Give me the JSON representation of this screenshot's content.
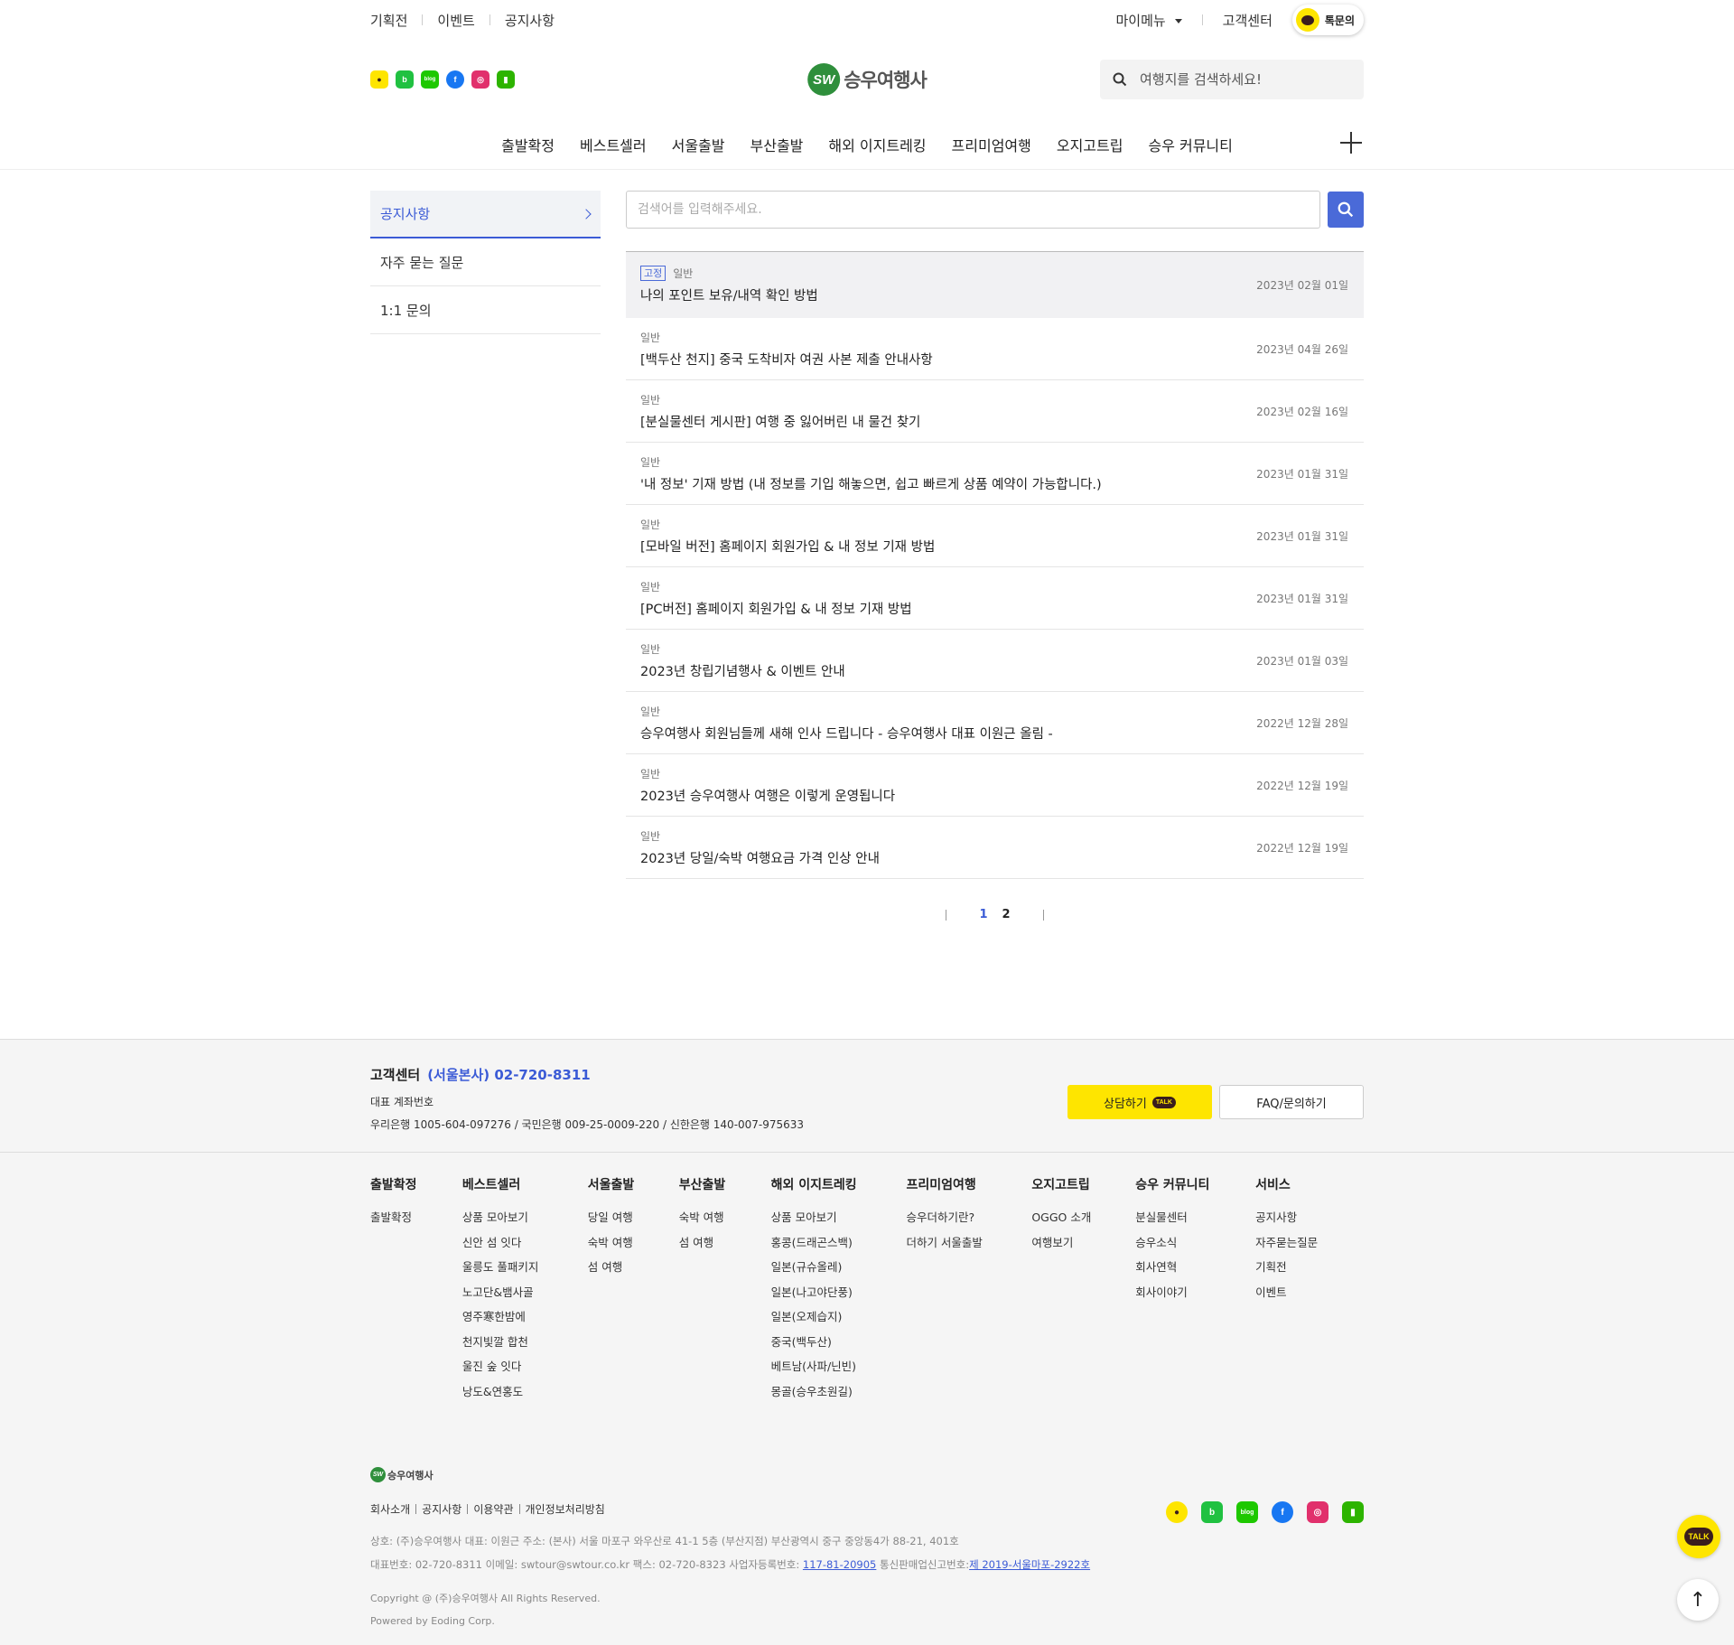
{
  "util_nav": [
    "기획전",
    "이벤트",
    "공지사항"
  ],
  "util_right": {
    "mymenu": "마이메뉴",
    "cs": "고객센터",
    "talk": "톡문의"
  },
  "sns": [
    {
      "icon": "kakaotalk-icon",
      "glyph": "●",
      "color": "#fee500"
    },
    {
      "icon": "band-icon",
      "glyph": "b",
      "color": "#20c141"
    },
    {
      "icon": "blog-icon",
      "glyph": "blog",
      "color": "#1ec800"
    },
    {
      "icon": "facebook-icon",
      "glyph": "f",
      "color": "#1877f2"
    },
    {
      "icon": "instagram-icon",
      "glyph": "◎",
      "color": "#e1306c"
    },
    {
      "icon": "naver-icon",
      "glyph": "▮",
      "color": "#2db400"
    }
  ],
  "logo": {
    "mark": "SW",
    "name": "승우여행사"
  },
  "top_search": {
    "placeholder": "여행지를 검색하세요!"
  },
  "gnb": [
    "출발확정",
    "베스트셀러",
    "서울출발",
    "부산출발",
    "해외 이지트레킹",
    "프리미엄여행",
    "오지고트립",
    "승우 커뮤니티"
  ],
  "lnb": [
    "공지사항",
    "자주 묻는 질문",
    "1:1 문의"
  ],
  "board_search": {
    "placeholder": "검색어를 입력해주세요."
  },
  "pinned": {
    "badge": "고정",
    "category": "일반",
    "title": "나의 포인트 보유/내역 확인 방법",
    "date": "2023년 02월 01일"
  },
  "notices": [
    {
      "category": "일반",
      "title": "[백두산 천지] 중국 도착비자 여권 사본 제출 안내사항",
      "date": "2023년 04월 26일"
    },
    {
      "category": "일반",
      "title": "[분실물센터 게시판] 여행 중 잃어버린 내 물건 찾기",
      "date": "2023년 02월 16일"
    },
    {
      "category": "일반",
      "title": "'내 정보' 기재 방법 (내 정보를 기입 해놓으면, 쉽고 빠르게 상품 예약이 가능합니다.)",
      "date": "2023년 01월 31일"
    },
    {
      "category": "일반",
      "title": "[모바일 버전] 홈페이지 회원가입 & 내 정보 기재 방법",
      "date": "2023년 01월 31일"
    },
    {
      "category": "일반",
      "title": "[PC버전] 홈페이지 회원가입 & 내 정보 기재 방법",
      "date": "2023년 01월 31일"
    },
    {
      "category": "일반",
      "title": "2023년 창립기념행사 & 이벤트 안내",
      "date": "2023년 01월 03일"
    },
    {
      "category": "일반",
      "title": "승우여행사 회원님들께 새해 인사 드립니다 - 승우여행사 대표 이원근 올림 -",
      "date": "2022년 12월 28일"
    },
    {
      "category": "일반",
      "title": "2023년 승우여행사 여행은 이렇게 운영됩니다",
      "date": "2022년 12월 19일"
    },
    {
      "category": "일반",
      "title": "2023년 당일/숙박 여행요금 가격 인상 안내",
      "date": "2022년 12월 19일"
    }
  ],
  "pager": {
    "pages": [
      "1",
      "2"
    ],
    "current": "1"
  },
  "footer_contact": {
    "title": "고객센터",
    "phone": "(서울본사) 02-720-8311",
    "account_label": "대표 계좌번호",
    "accounts": "우리은행 1005-604-097276 / 국민은행 009-25-0009-220 / 신한은행 140-007-975633",
    "consult_btn": "상담하기",
    "talk_badge": "TALK",
    "faq_btn": "FAQ/문의하기"
  },
  "sitemap": [
    {
      "title": "출발확정",
      "items": [
        "출발확정"
      ]
    },
    {
      "title": "베스트셀러",
      "items": [
        "상품 모아보기",
        "신안 섬 잇다",
        "울릉도 풀패키지",
        "노고단&뱀사골",
        "영주寒한밤에",
        "천지빛깔 합천",
        "울진 숲 잇다",
        "낭도&연홍도"
      ]
    },
    {
      "title": "서울출발",
      "items": [
        "당일 여행",
        "숙박 여행",
        "섬 여행"
      ]
    },
    {
      "title": "부산출발",
      "items": [
        "숙박 여행",
        "섬 여행"
      ]
    },
    {
      "title": "해외 이지트레킹",
      "items": [
        "상품 모아보기",
        "홍콩(드래곤스백)",
        "일본(규슈올레)",
        "일본(나고야단풍)",
        "일본(오제습지)",
        "중국(백두산)",
        "베트남(사파/닌빈)",
        "몽골(승우초원길)"
      ]
    },
    {
      "title": "프리미엄여행",
      "items": [
        "승우더하기란?",
        "더하기 서울출발"
      ]
    },
    {
      "title": "오지고트립",
      "items": [
        "OGGO 소개",
        "여행보기"
      ]
    },
    {
      "title": "승우 커뮤니티",
      "items": [
        "분실물센터",
        "승우소식",
        "회사연혁",
        "회사이야기"
      ]
    },
    {
      "title": "서비스",
      "items": [
        "공지사항",
        "자주묻는질문",
        "기획전",
        "이벤트"
      ]
    }
  ],
  "footer_links": [
    "회사소개",
    "공지사항",
    "이용약관",
    "개인정보처리방침"
  ],
  "footer_info": {
    "line1": "상호: (주)승우여행사    대표: 이원근    주소: (본사) 서울 마포구 와우산로 41-1 5층 (부산지점) 부산광역시 중구 중앙동4가 88-21, 401호",
    "line2_prefix": "대표번호: 02-720-8311    이메일: swtour@swtour.co.kr    팩스: 02-720-8323    사업자등록번호: ",
    "biz_no": "117-81-20905",
    "line2_mid": "    통신판매업신고번호:",
    "mail_no": "제 2019-서울마포-2922호",
    "copyright": "Copyright @ (주)승우여행사 All Rights Reserved.",
    "powered": "Powered by Eoding Corp."
  },
  "floating": {
    "talk": "TALK",
    "top_arrow": "↑"
  }
}
